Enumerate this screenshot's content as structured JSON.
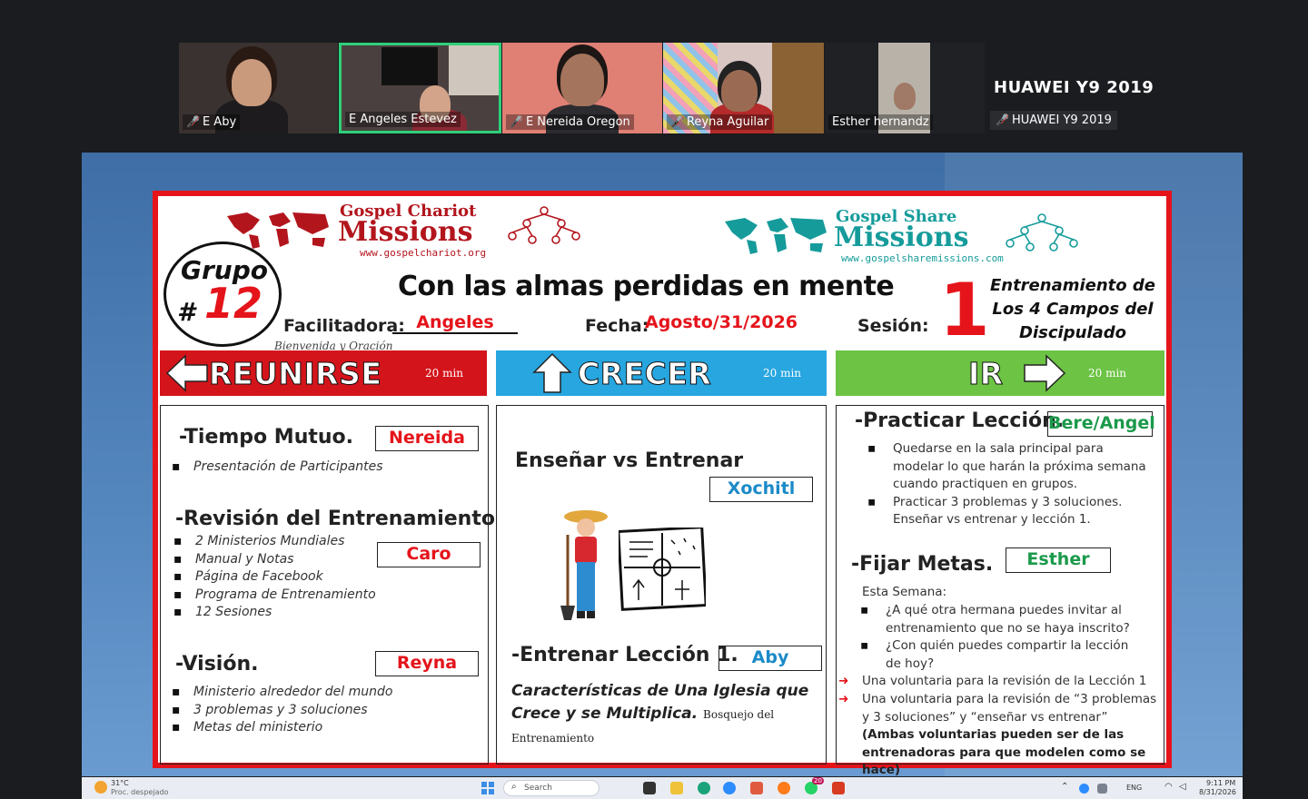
{
  "participants": [
    {
      "name": "E Aby",
      "muted": true
    },
    {
      "name": "E Angeles Estevez",
      "muted": false,
      "active": true
    },
    {
      "name": "E Nereida Oregon",
      "muted": true
    },
    {
      "name": "Reyna Aguilar",
      "muted": true
    },
    {
      "name": "Esther hernandz",
      "muted": false
    }
  ],
  "huawei": {
    "title": "HUAWEI Y9 2019",
    "name": "HUAWEI Y9 2019"
  },
  "slide": {
    "logo_left": {
      "line1": "Gospel Chariot",
      "line2": "Missions",
      "url": "www.gospelchariot.org",
      "color": "#b3151d"
    },
    "logo_right": {
      "line1": "Gospel Share",
      "line2": "Missions",
      "url": "www.gospelsharemissions.com",
      "color": "#169b9b"
    },
    "grupo": {
      "word": "Grupo",
      "hash": "#",
      "number": "12"
    },
    "headline": "Con las almas perdidas en mente",
    "facilitadora_label": "Facilitadora:",
    "facilitadora": "Angeles",
    "welcome": "Bienvenida y Oración",
    "fecha_label": "Fecha:",
    "fecha": "Agosto/31/2026",
    "sesion_label": "Sesión:",
    "sesion": "1",
    "training": "Entrenamiento de Los 4 Campos del Discipulado",
    "bands": {
      "reunirse": {
        "title": "REUNIRSE",
        "minutes": "20 min",
        "color": "#d4141b"
      },
      "crecer": {
        "title": "CRECER",
        "minutes": "20 min",
        "color": "#27a6e0"
      },
      "ir": {
        "title": "IR",
        "minutes": "20 min",
        "color": "#6cc344"
      }
    },
    "col1": {
      "tiempo": "-Tiempo Mutuo.",
      "tiempo_tag": "Nereida",
      "tiempo_items": [
        "Presentación de Participantes"
      ],
      "revision": "-Revisión del Entrenamiento",
      "revision_tag": "Caro",
      "revision_items": [
        "2 Ministerios Mundiales",
        "Manual y Notas",
        "Página de Facebook",
        "Programa de Entrenamiento",
        "12 Sesiones"
      ],
      "vision": "-Visión.",
      "vision_tag": "Reyna",
      "vision_items": [
        "Ministerio alrededor del mundo",
        "3 problemas y 3 soluciones",
        "Metas del ministerio"
      ]
    },
    "col2": {
      "ensenar": "Enseñar vs Entrenar",
      "ensenar_tag": "Xochitl",
      "entrenar": "-Entrenar Lección 1.",
      "entrenar_tag": "Aby",
      "caracteristicas": "Características de Una Iglesia que Crece y se Multiplica.",
      "bosquejo": "Bosquejo del Entrenamiento"
    },
    "col3": {
      "practicar": "-Practicar Lección.",
      "practicar_tag": "Bere/Angel",
      "practicar_items": [
        "Quedarse en la sala principal para modelar lo que harán la próxima semana cuando practiquen en grupos.",
        "Practicar 3 problemas y 3 soluciones. Enseñar vs entrenar y lección 1."
      ],
      "fijar": "-Fijar Metas.",
      "fijar_tag": "Esther",
      "esta_semana": "Esta Semana:",
      "fijar_items": [
        "¿A qué otra hermana puedes invitar al entrenamiento que no se haya inscrito?",
        "¿Con quién puedes compartir la lección de hoy?"
      ],
      "voluntaria1": "Una voluntaria para la revisión de la Lección 1",
      "voluntaria2": "Una voluntaria para la revisión de “3 problemas y 3 soluciones” y “enseñar vs entrenar”",
      "nota": "(Ambas voluntarias pueden ser de las entrenadoras para que modelen como se hace)"
    }
  },
  "taskbar": {
    "weather_temp": "31°C",
    "weather_desc": "Proc. despejado",
    "search": "Search",
    "lang": "ENG",
    "time": "9:11 PM",
    "date": "8/31/2026",
    "badge": "20"
  }
}
